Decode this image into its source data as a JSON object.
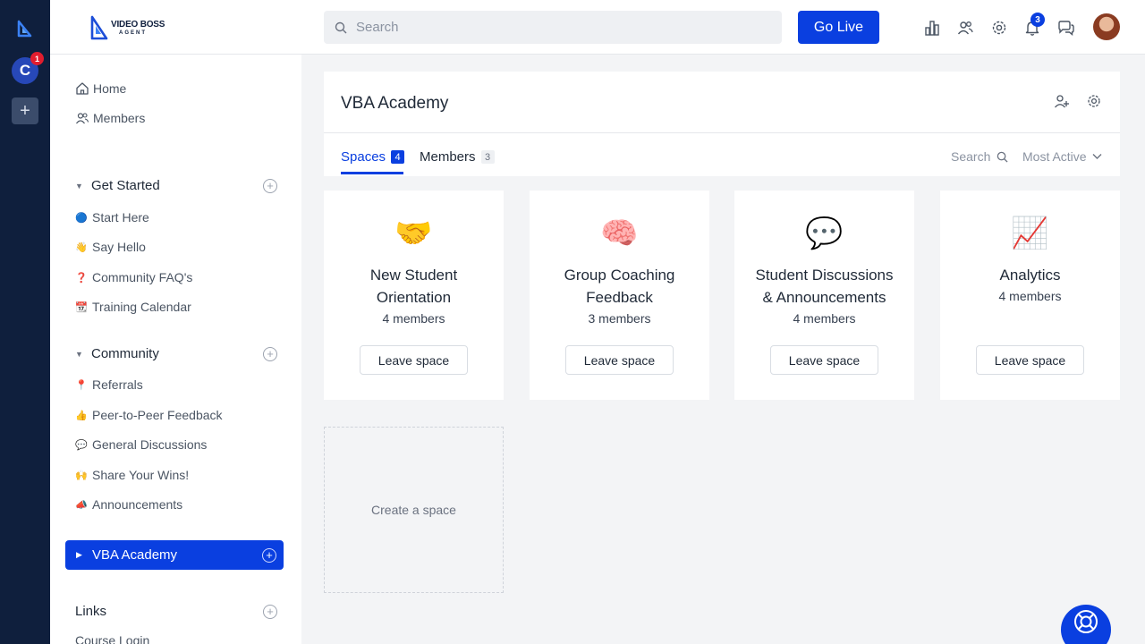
{
  "rail": {
    "community_initial": "C",
    "community_badge": "1",
    "add_label": "+"
  },
  "header": {
    "brand_line1": "VIDEO BOSS",
    "brand_line2": "AGENT",
    "search_placeholder": "Search",
    "go_live_label": "Go Live",
    "notification_count": "3"
  },
  "sidebar": {
    "home": "Home",
    "members": "Members",
    "get_started": {
      "title": "Get Started",
      "items": [
        {
          "emoji": "🔵",
          "label": "Start Here"
        },
        {
          "emoji": "👋",
          "label": "Say Hello"
        },
        {
          "emoji": "❓",
          "label": "Community FAQ's"
        },
        {
          "emoji": "📆",
          "label": "Training Calendar"
        }
      ]
    },
    "community": {
      "title": "Community",
      "items": [
        {
          "emoji": "📍",
          "label": "Referrals"
        },
        {
          "emoji": "👍",
          "label": "Peer-to-Peer Feedback"
        },
        {
          "emoji": "💬",
          "label": "General Discussions"
        },
        {
          "emoji": "🙌",
          "label": "Share Your Wins!"
        },
        {
          "emoji": "📣",
          "label": "Announcements"
        }
      ]
    },
    "active": "VBA Academy",
    "links": {
      "title": "Links",
      "items": [
        {
          "label": "Course Login"
        }
      ]
    }
  },
  "main": {
    "title": "VBA Academy",
    "tabs": [
      {
        "label": "Spaces",
        "count": "4"
      },
      {
        "label": "Members",
        "count": "3"
      }
    ],
    "search_label": "Search",
    "sort_label": "Most Active",
    "leave_label": "Leave space",
    "cards": [
      {
        "emoji": "🤝",
        "name": "New Student Orientation",
        "count": "4 members"
      },
      {
        "emoji": "🧠",
        "name": "Group Coaching Feedback",
        "count": "3 members"
      },
      {
        "emoji": "💬",
        "name": "Student Discussions & Announcements",
        "count": "4 members"
      },
      {
        "emoji": "📈",
        "name": "Analytics",
        "count": "4 members"
      }
    ],
    "create_label": "Create a space"
  },
  "colors": {
    "accent": "#0a3fe0",
    "rail": "#0f1f3d",
    "badge_red": "#e11d2e"
  },
  "icons": [
    "leaderboard-icon",
    "members-icon",
    "gear-icon",
    "bell-icon",
    "chat-icon",
    "lifebuoy-icon"
  ]
}
